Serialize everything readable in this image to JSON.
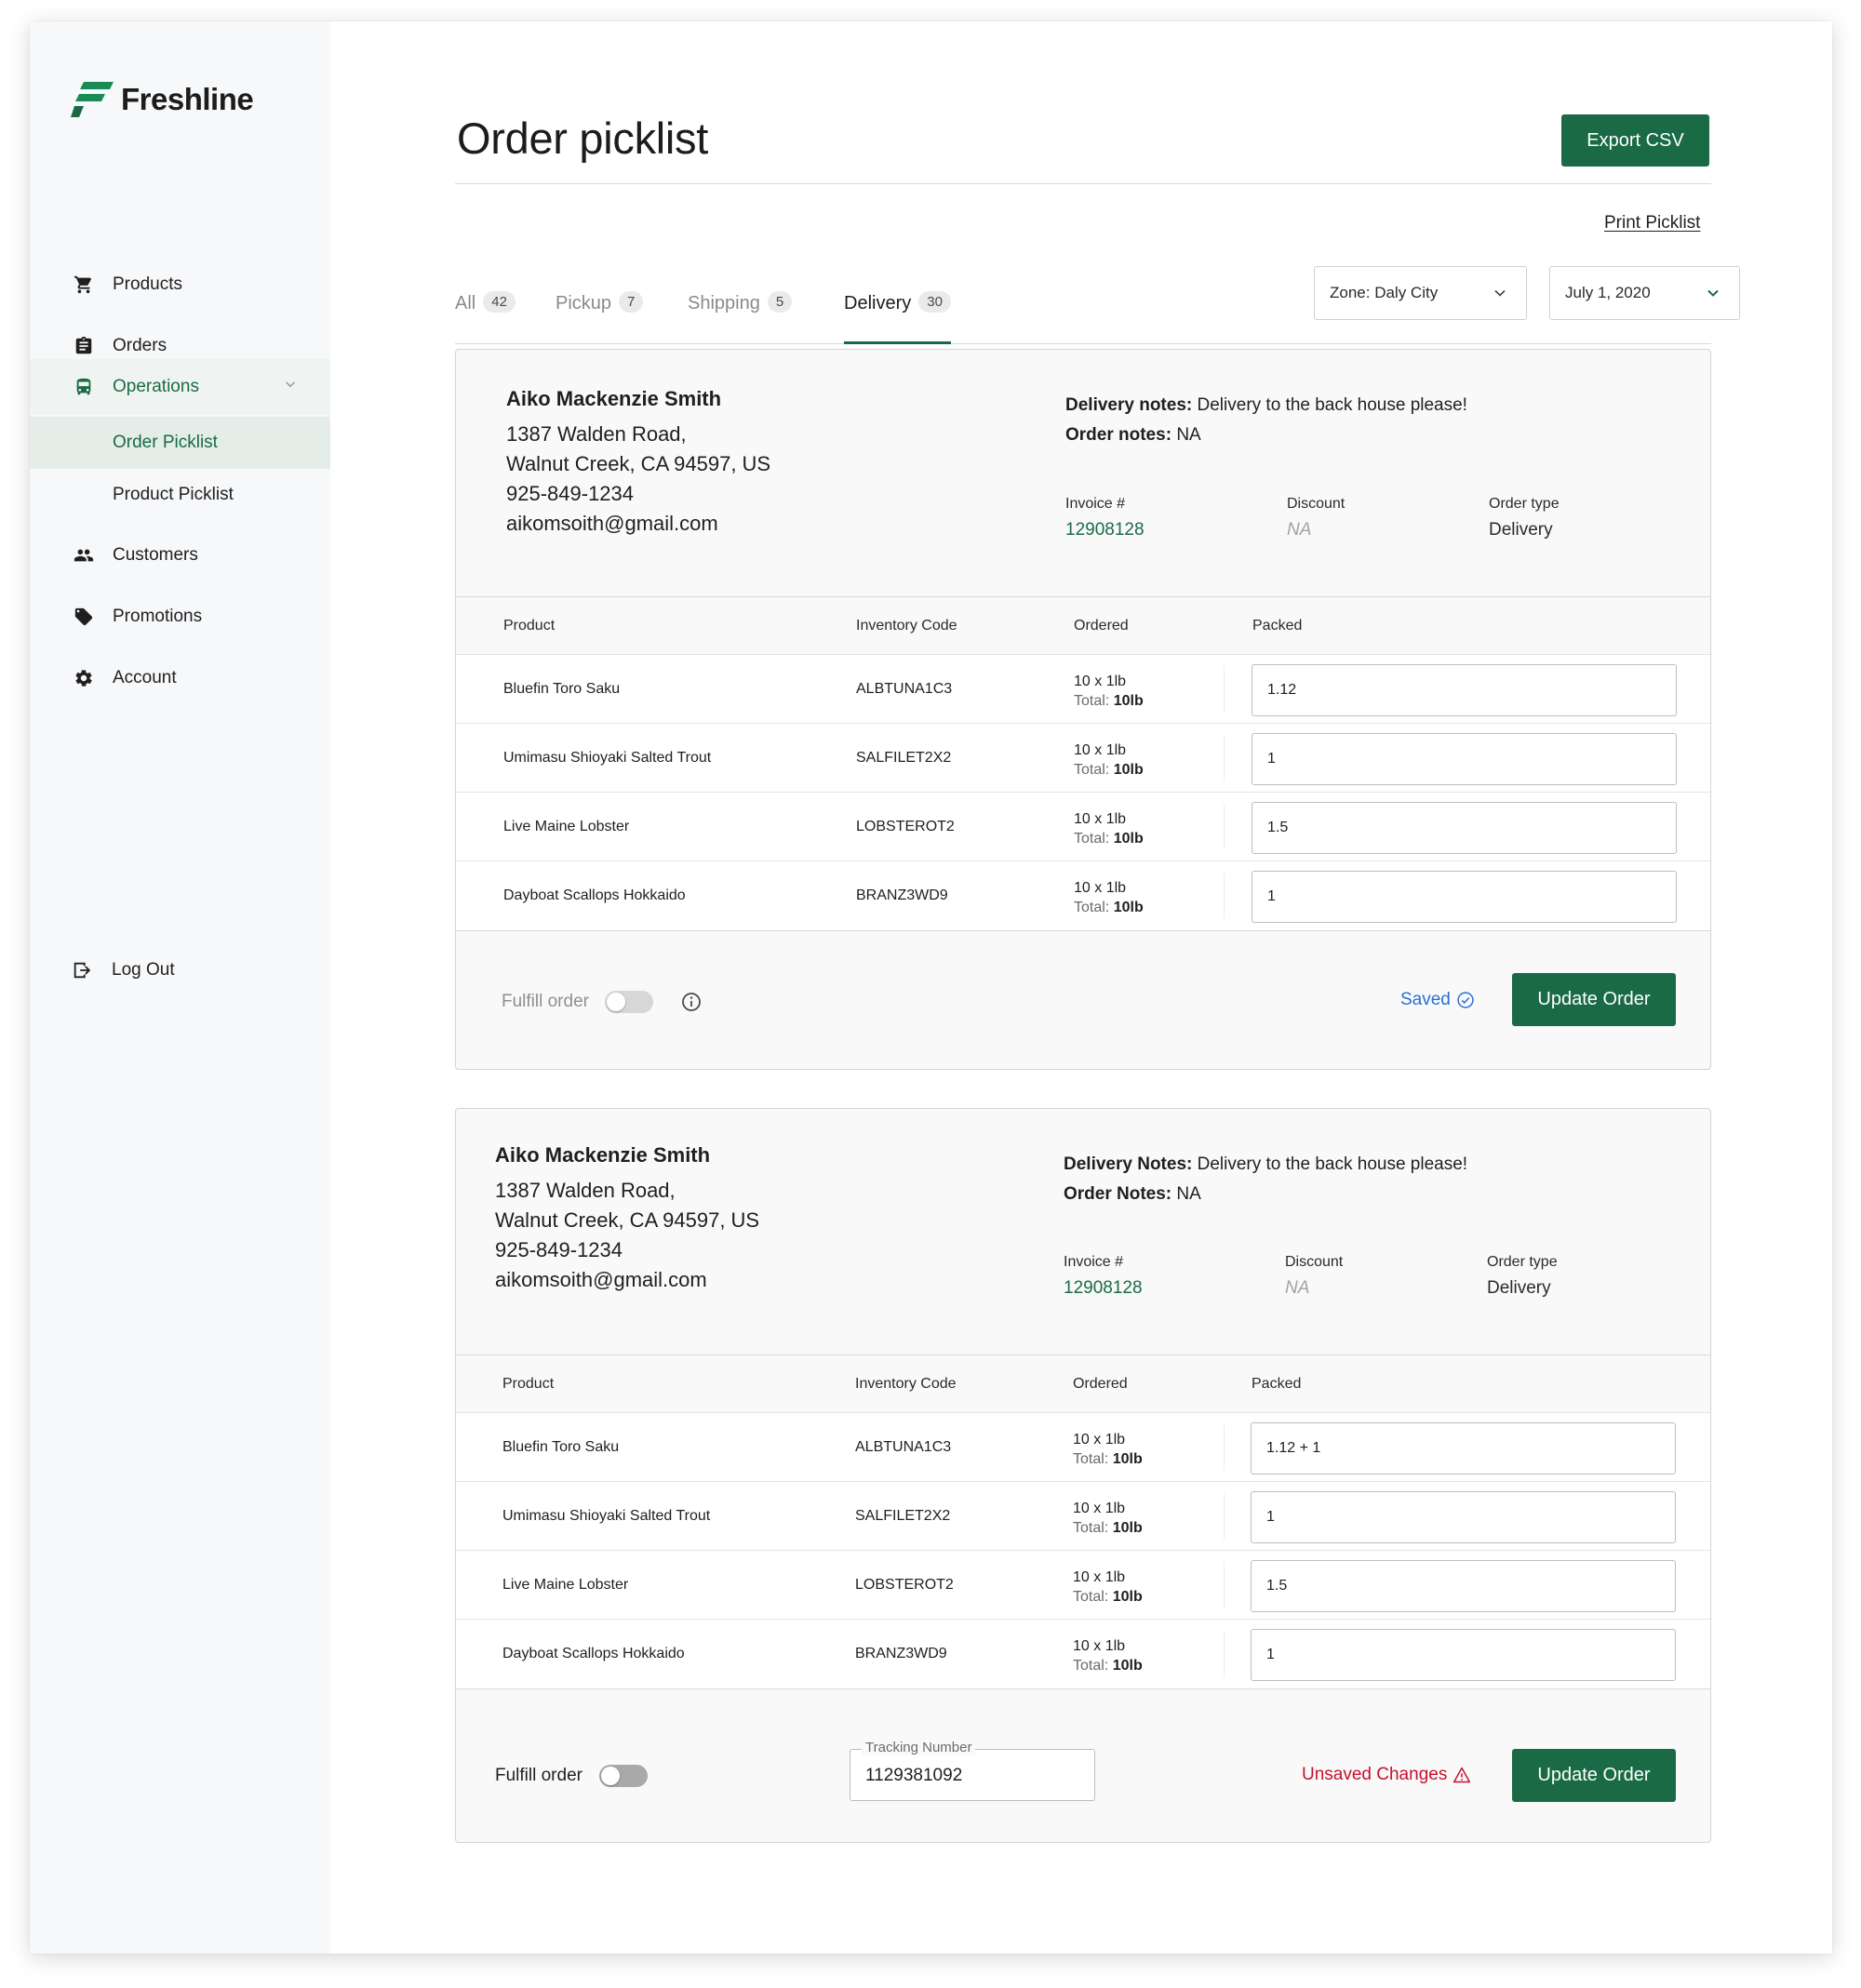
{
  "brand": {
    "name": "Freshline",
    "color": "#1a6b45"
  },
  "sidebar": {
    "items": [
      {
        "label": "Products",
        "icon": "cart-icon"
      },
      {
        "label": "Orders",
        "icon": "clipboard-icon"
      },
      {
        "label": "Operations",
        "icon": "truck-icon"
      },
      {
        "label": "Order Picklist"
      },
      {
        "label": "Product Picklist"
      },
      {
        "label": "Customers",
        "icon": "people-icon"
      },
      {
        "label": "Promotions",
        "icon": "tag-icon"
      },
      {
        "label": "Account",
        "icon": "gear-icon"
      }
    ],
    "logout_label": "Log Out"
  },
  "header": {
    "title": "Order picklist",
    "export_label": "Export CSV",
    "print_label": "Print Picklist"
  },
  "tabs": [
    {
      "label": "All",
      "count": "42"
    },
    {
      "label": "Pickup",
      "count": "7"
    },
    {
      "label": "Shipping",
      "count": "5"
    },
    {
      "label": "Delivery",
      "count": "30"
    }
  ],
  "filters": {
    "zone": "Zone: Daly City",
    "date": "July 1, 2020"
  },
  "table_headers": {
    "product": "Product",
    "code": "Inventory Code",
    "ordered": "Ordered",
    "packed": "Packed"
  },
  "orders": [
    {
      "customer": {
        "name": "Aiko Mackenzie Smith",
        "address1": "1387 Walden Road,",
        "address2": "Walnut Creek, CA 94597, US",
        "phone": "925-849-1234",
        "email": "aikomsoith@gmail.com"
      },
      "delivery_notes_label": "Delivery notes:",
      "delivery_notes": "Delivery to the back house please!",
      "order_notes_label": "Order notes:",
      "order_notes": "NA",
      "invoice_label": "Invoice #",
      "invoice": "12908128",
      "discount_label": "Discount",
      "discount": "NA",
      "order_type_label": "Order type",
      "order_type": "Delivery",
      "items": [
        {
          "product": "Bluefin Toro Saku",
          "code": "ALBTUNA1C3",
          "ordered": "10 x 1lb",
          "total_label": "Total:",
          "total": "10lb",
          "packed": "1.12"
        },
        {
          "product": "Umimasu Shioyaki Salted Trout",
          "code": "SALFILET2X2",
          "ordered": "10 x 1lb",
          "total_label": "Total:",
          "total": "10lb",
          "packed": "1"
        },
        {
          "product": "Live Maine Lobster",
          "code": "LOBSTEROT2",
          "ordered": "10 x 1lb",
          "total_label": "Total:",
          "total": "10lb",
          "packed": "1.5"
        },
        {
          "product": "Dayboat Scallops Hokkaido",
          "code": "BRANZ3WD9",
          "ordered": "10 x 1lb",
          "total_label": "Total:",
          "total": "10lb",
          "packed": "1"
        }
      ],
      "fulfill_label": "Fulfill order",
      "status": "Saved",
      "update_label": "Update Order"
    },
    {
      "customer": {
        "name": "Aiko Mackenzie Smith",
        "address1": "1387 Walden Road,",
        "address2": "Walnut Creek, CA 94597, US",
        "phone": "925-849-1234",
        "email": "aikomsoith@gmail.com"
      },
      "delivery_notes_label": "Delivery Notes:",
      "delivery_notes": "Delivery to the back house please!",
      "order_notes_label": "Order Notes:",
      "order_notes": "NA",
      "invoice_label": "Invoice #",
      "invoice": "12908128",
      "discount_label": "Discount",
      "discount": "NA",
      "order_type_label": "Order type",
      "order_type": "Delivery",
      "items": [
        {
          "product": "Bluefin Toro Saku",
          "code": "ALBTUNA1C3",
          "ordered": "10 x 1lb",
          "total_label": "Total:",
          "total": "10lb",
          "packed": "1.12 + 1"
        },
        {
          "product": "Umimasu Shioyaki Salted Trout",
          "code": "SALFILET2X2",
          "ordered": "10 x 1lb",
          "total_label": "Total:",
          "total": "10lb",
          "packed": "1"
        },
        {
          "product": "Live Maine Lobster",
          "code": "LOBSTEROT2",
          "ordered": "10 x 1lb",
          "total_label": "Total:",
          "total": "10lb",
          "packed": "1.5"
        },
        {
          "product": "Dayboat Scallops Hokkaido",
          "code": "BRANZ3WD9",
          "ordered": "10 x 1lb",
          "total_label": "Total:",
          "total": "10lb",
          "packed": "1"
        }
      ],
      "fulfill_label": "Fulfill order",
      "tracking_label": "Tracking Number",
      "tracking": "1129381092",
      "status": "Unsaved Changes",
      "update_label": "Update Order"
    }
  ]
}
